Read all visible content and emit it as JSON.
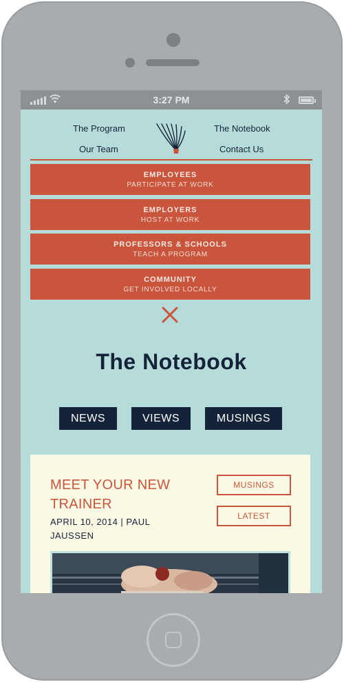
{
  "status_bar": {
    "time": "3:27 PM"
  },
  "nav": {
    "program": "The Program",
    "notebook": "The Notebook",
    "team": "Our Team",
    "contact": "Contact Us"
  },
  "menu": [
    {
      "title": "EMPLOYEES",
      "subtitle": "PARTICIPATE AT WORK"
    },
    {
      "title": "EMPLOYERS",
      "subtitle": "HOST AT WORK"
    },
    {
      "title": "PROFESSORS & SCHOOLS",
      "subtitle": "TEACH A PROGRAM"
    },
    {
      "title": "COMMUNITY",
      "subtitle": "GET INVOLVED LOCALLY"
    }
  ],
  "page": {
    "title": "The Notebook",
    "categories": [
      "NEWS",
      "VIEWS",
      "MUSINGS"
    ]
  },
  "post": {
    "title": "MEET YOUR NEW TRAINER",
    "meta": "APRIL 10, 2014  |  PAUL JAUSSEN",
    "tags": [
      "MUSINGS",
      "LATEST"
    ]
  },
  "colors": {
    "background": "#b5dcd9",
    "accent": "#c9553d",
    "navy": "#15233a",
    "card": "#fbf9e4"
  }
}
